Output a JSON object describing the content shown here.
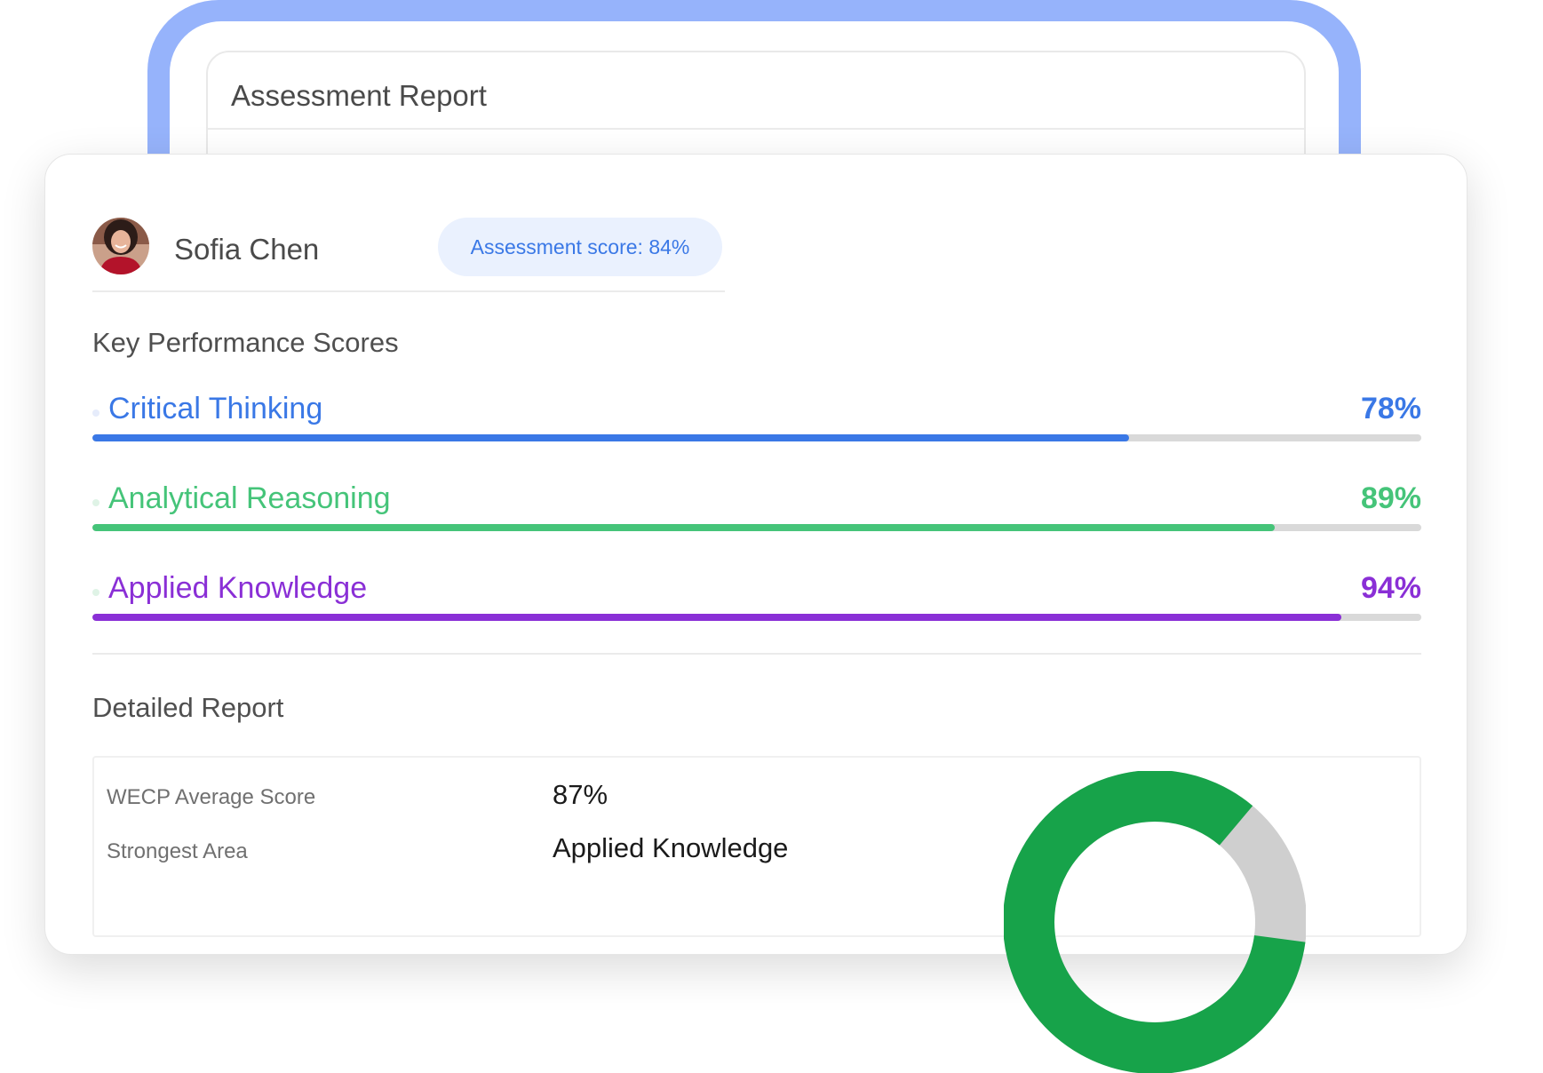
{
  "back_card": {
    "title": "Assessment Report"
  },
  "candidate": {
    "name": "Sofia Chen",
    "score_badge": "Assessment score: 84%"
  },
  "key_scores": {
    "title": "Key Performance Scores",
    "items": [
      {
        "label": "Critical Thinking",
        "value": "78%",
        "fraction": 0.78,
        "color": "#3a78e6"
      },
      {
        "label": "Analytical Reasoning",
        "value": "89%",
        "fraction": 0.89,
        "color": "#45c479"
      },
      {
        "label": "Applied Knowledge",
        "value": "94%",
        "fraction": 0.94,
        "color": "#8a2fd6"
      }
    ]
  },
  "detailed_report": {
    "title": "Detailed Report",
    "rows": [
      {
        "label": "WECP Average Score",
        "value": "87%"
      },
      {
        "label": "Strongest Area",
        "value": "Applied Knowledge"
      }
    ]
  },
  "donut": {
    "fraction": 0.84,
    "color": "#17a34a",
    "track_color": "#cfcfcf"
  }
}
